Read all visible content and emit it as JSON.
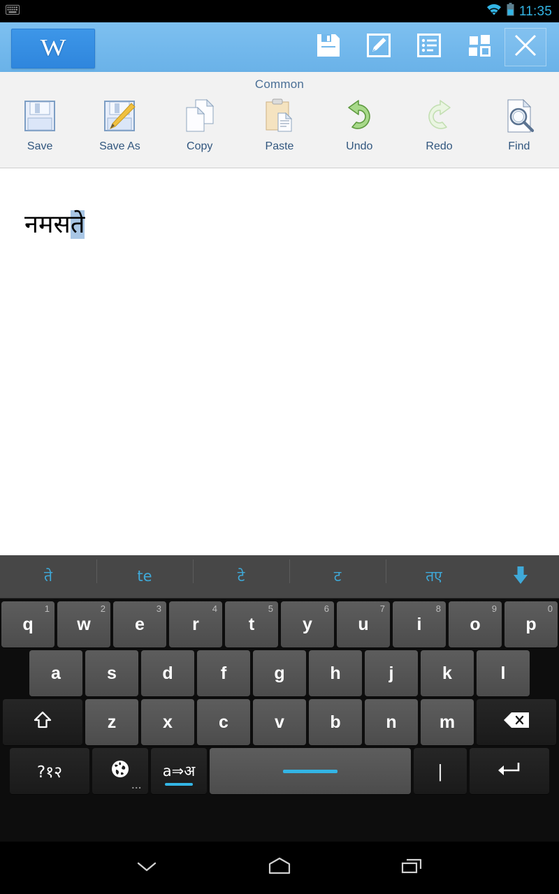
{
  "status_bar": {
    "notification_icon": "keyboard-icon",
    "wifi_icon": "wifi-icon",
    "battery_icon": "battery-icon",
    "time": "11:35",
    "accent_color": "#33b5e5"
  },
  "top_bar": {
    "app_logo_letter": "W",
    "background_color": "#72b8ec",
    "actions": [
      {
        "name": "save-icon",
        "label": "Save"
      },
      {
        "name": "edit-icon",
        "label": "Edit"
      },
      {
        "name": "outline-icon",
        "label": "Outline"
      },
      {
        "name": "apps-grid-icon",
        "label": "Apps"
      },
      {
        "name": "close-icon",
        "label": "Close"
      }
    ]
  },
  "ribbon": {
    "title": "Common",
    "items": [
      {
        "label": "Save",
        "icon": "floppy-disk-icon",
        "disabled": false
      },
      {
        "label": "Save As",
        "icon": "floppy-disk-pencil-icon",
        "disabled": false
      },
      {
        "label": "Copy",
        "icon": "copy-pages-icon",
        "disabled": false
      },
      {
        "label": "Paste",
        "icon": "clipboard-paste-icon",
        "disabled": false
      },
      {
        "label": "Undo",
        "icon": "undo-arrow-icon",
        "disabled": false
      },
      {
        "label": "Redo",
        "icon": "redo-arrow-icon",
        "disabled": true
      },
      {
        "label": "Find",
        "icon": "find-magnifier-icon",
        "disabled": false
      }
    ]
  },
  "document": {
    "text_committed": "नमस",
    "text_composing": "ते",
    "composing_highlight_color": "#a8c6e5",
    "background_color": "#ffffff"
  },
  "keyboard": {
    "suggestions": [
      "ते",
      "te",
      "टे",
      "ट",
      "तए"
    ],
    "expand_icon": "down-arrow-icon",
    "suggestion_color": "#3fa9d8",
    "row1": [
      {
        "key": "q",
        "hint": "1"
      },
      {
        "key": "w",
        "hint": "2"
      },
      {
        "key": "e",
        "hint": "3"
      },
      {
        "key": "r",
        "hint": "4"
      },
      {
        "key": "t",
        "hint": "5"
      },
      {
        "key": "y",
        "hint": "6"
      },
      {
        "key": "u",
        "hint": "7"
      },
      {
        "key": "i",
        "hint": "8"
      },
      {
        "key": "o",
        "hint": "9"
      },
      {
        "key": "p",
        "hint": "0"
      }
    ],
    "row2": [
      "a",
      "s",
      "d",
      "f",
      "g",
      "h",
      "j",
      "k",
      "l"
    ],
    "row3": {
      "shift_icon": "shift-arrow-icon",
      "letters": [
        "z",
        "x",
        "c",
        "v",
        "b",
        "n",
        "m"
      ],
      "backspace_icon": "backspace-icon"
    },
    "row4": {
      "symbols_label": "?१२",
      "globe_icon": "globe-icon",
      "globe_more": "...",
      "translit_label": "a⇒अ",
      "space_label": "",
      "pipe_label": "|",
      "enter_icon": "enter-arrow-icon",
      "indicator_color": "#33b5e5"
    }
  },
  "nav_bar": {
    "back_icon": "chevron-down-icon",
    "home_icon": "home-pentagon-icon",
    "recents_icon": "recents-icon"
  }
}
